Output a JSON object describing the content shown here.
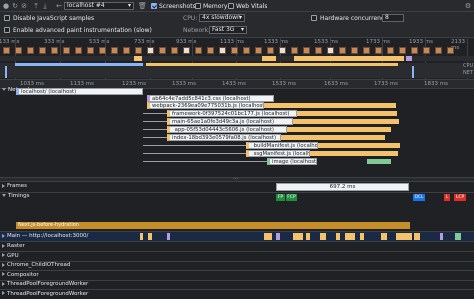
{
  "toolbar": {
    "tab_title": "localhost #4",
    "screenshots_label": "Screenshots",
    "memory_label": "Memory",
    "web_vitals_label": "Web Vitals"
  },
  "settings": {
    "disable_js_samples_label": "Disable JavaScript samples",
    "advanced_paint_label": "Enable advanced paint instrumentation (slow)",
    "cpu_label": "CPU:",
    "cpu_value": "4x slowdown",
    "network_label": "Network:",
    "network_value": "Fast 3G",
    "hardware_concurrency_label": "Hardware concurrency",
    "hardware_concurrency_value": "8"
  },
  "overview": {
    "ticks": [
      "133 ms",
      "333 ms",
      "533 ms",
      "733 ms",
      "933 ms",
      "1133 ms",
      "1333 ms",
      "1533 ms",
      "1733 ms",
      "1933 ms",
      "2133 ms"
    ],
    "right_labels": [
      "CPU",
      "NET"
    ]
  },
  "network": {
    "title": "Network",
    "ruler_ticks": [
      "1033 ms",
      "1133 ms",
      "1233 ms",
      "1333 ms",
      "1433 ms",
      "1533 ms",
      "1633 ms",
      "1733 ms",
      "1833 ms"
    ],
    "requests": [
      {
        "label": "localhost/ (localhost)",
        "color": "#8ab4f8"
      },
      {
        "label": "ab64c4e7add5c841c3.css (localhost)",
        "color": "#b39ddb"
      },
      {
        "label": "webpack-2369ea09e775031b.js (localhost)",
        "color": "#f4c26b"
      },
      {
        "label": "framework-0f397524c01bc177.js (localhost)",
        "color": "#f4c26b"
      },
      {
        "label": "main-65ae1a0fe3d49c3a.js (localhost)",
        "color": "#f4c26b"
      },
      {
        "label": "_app-05f53d04443c5606.js (localhost)",
        "color": "#f4c26b"
      },
      {
        "label": "index-18bd393e0579fa08.js (localhost)",
        "color": "#f4c26b"
      },
      {
        "label": "_buildManifest.js (localhost)",
        "color": "#f4c26b"
      },
      {
        "label": "_ssgManifest.js (localhost)",
        "color": "#f4c26b"
      },
      {
        "label": "image (localhost)",
        "color": "#81c995"
      }
    ]
  },
  "timeline": {
    "frames_label": "Frames",
    "frame_time": "697.2 ms",
    "timings_label": "Timings",
    "markers": {
      "fp": "FP",
      "fcp": "FCP",
      "dcl": "DCL",
      "lcp": "LCP",
      "l": "L"
    },
    "nextjs_label": "Next.js-before-hydration",
    "main_label": "Main — http://localhost:3000/",
    "tracks": [
      "Raster",
      "GPU",
      "Chrome_ChildIOThread",
      "Compositor",
      "ThreadPoolForegroundWorker",
      "ThreadPoolForegroundWorker"
    ]
  }
}
